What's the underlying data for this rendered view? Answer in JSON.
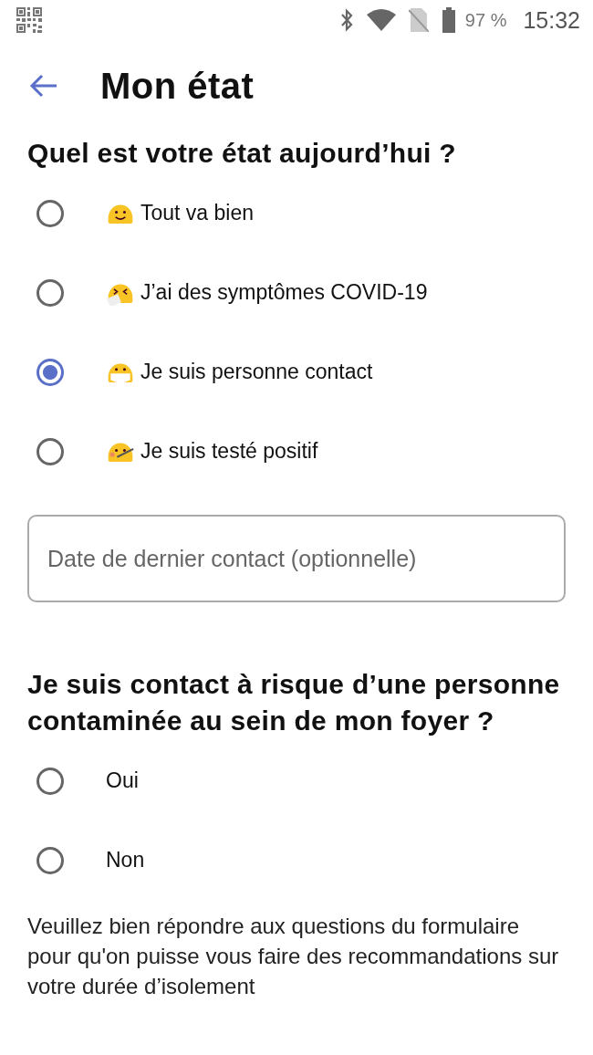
{
  "status_bar": {
    "battery": "97 %",
    "time": "15:32"
  },
  "header": {
    "title": "Mon état"
  },
  "state_question": {
    "title": "Quel est votre état aujourd’hui ?",
    "options": [
      {
        "label": "Tout va bien",
        "kind": "smile",
        "selected": false
      },
      {
        "label": "J’ai des symptômes COVID-19",
        "kind": "sneeze",
        "selected": false
      },
      {
        "label": "Je suis personne contact",
        "kind": "mask",
        "selected": true
      },
      {
        "label": "Je suis testé positif",
        "kind": "thermometer",
        "selected": false
      }
    ]
  },
  "date_field": {
    "placeholder": "Date de dernier contact (optionnelle)"
  },
  "household_question": {
    "title": "Je suis contact à risque d’une personne contaminée au sein de mon foyer ?",
    "options": [
      {
        "label": "Oui",
        "selected": false
      },
      {
        "label": "Non",
        "selected": false
      }
    ]
  },
  "notice": "Veuillez bien répondre aux questions du formulaire pour qu'on puisse vous faire des recommandations sur votre durée d’isolement"
}
